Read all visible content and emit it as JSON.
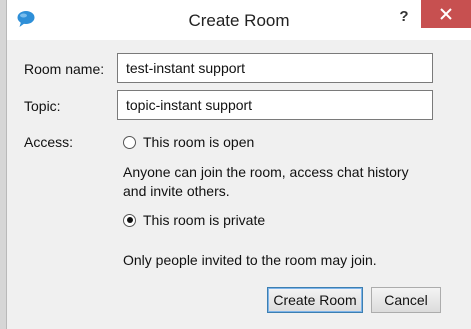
{
  "dialog": {
    "title": "Create Room",
    "help_label": "?",
    "close_icon": "close-icon",
    "app_icon": "chat-bubble-icon"
  },
  "form": {
    "room_name_label": "Room name:",
    "room_name_value": "test-instant support",
    "topic_label": "Topic:",
    "topic_value": "topic-instant support",
    "access_label": "Access:",
    "options": [
      {
        "label": "This room is open",
        "checked": false,
        "description": [
          "Anyone can join the room, access chat history",
          "and invite others."
        ]
      },
      {
        "label": "This room is private",
        "checked": true,
        "description": [
          "Only people invited to the room may join."
        ]
      }
    ]
  },
  "buttons": {
    "create_label": "Create Room",
    "cancel_label": "Cancel"
  },
  "colors": {
    "close_button": "#c75050",
    "chat_icon": "#2e8fd8",
    "default_button_border": "#3c7fb1"
  }
}
